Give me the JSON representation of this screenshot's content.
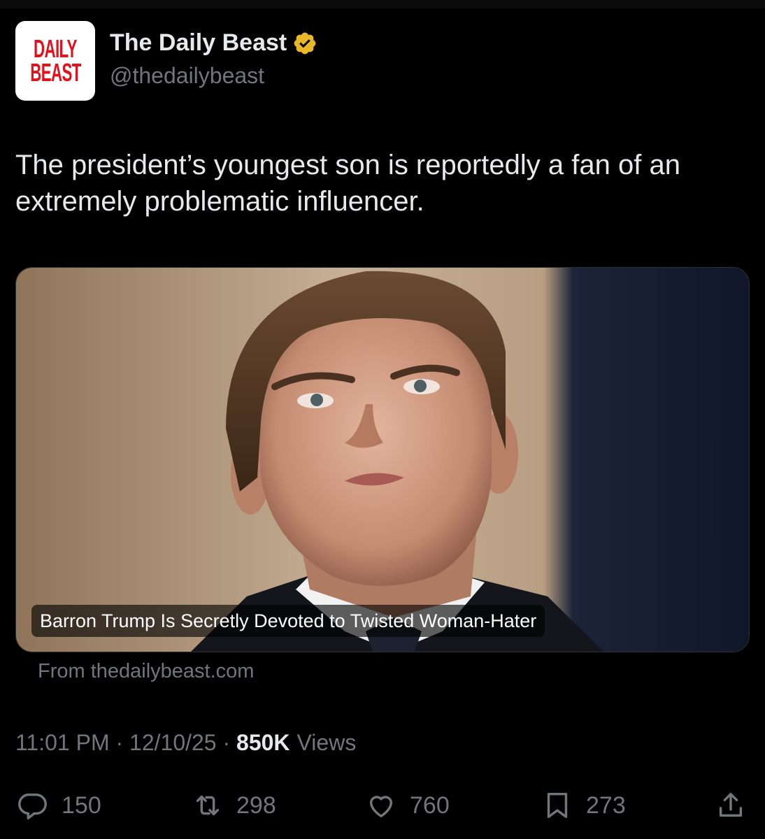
{
  "account": {
    "display_name": "The Daily Beast",
    "handle": "@thedailybeast",
    "logo_line1": "DAILY",
    "logo_line2": "BEAST",
    "verified_color": "#e8b829",
    "logo_color": "#e3111b"
  },
  "tweet": {
    "text": "The president’s youngest son is reportedly a fan of an extremely problematic influencer."
  },
  "card": {
    "title": "Barron Trump Is Secretly Devoted to Twisted Woman-Hater",
    "source": "From thedailybeast.com"
  },
  "meta": {
    "time": "11:01 PM",
    "date": "12/10/25",
    "views_count": "850K",
    "views_label": "Views",
    "separator": " · "
  },
  "actions": {
    "replies": "150",
    "reposts": "298",
    "likes": "760",
    "bookmarks": "273"
  },
  "icons": {
    "reply": "reply-icon",
    "repost": "repost-icon",
    "like": "heart-icon",
    "bookmark": "bookmark-icon",
    "share": "share-icon"
  }
}
